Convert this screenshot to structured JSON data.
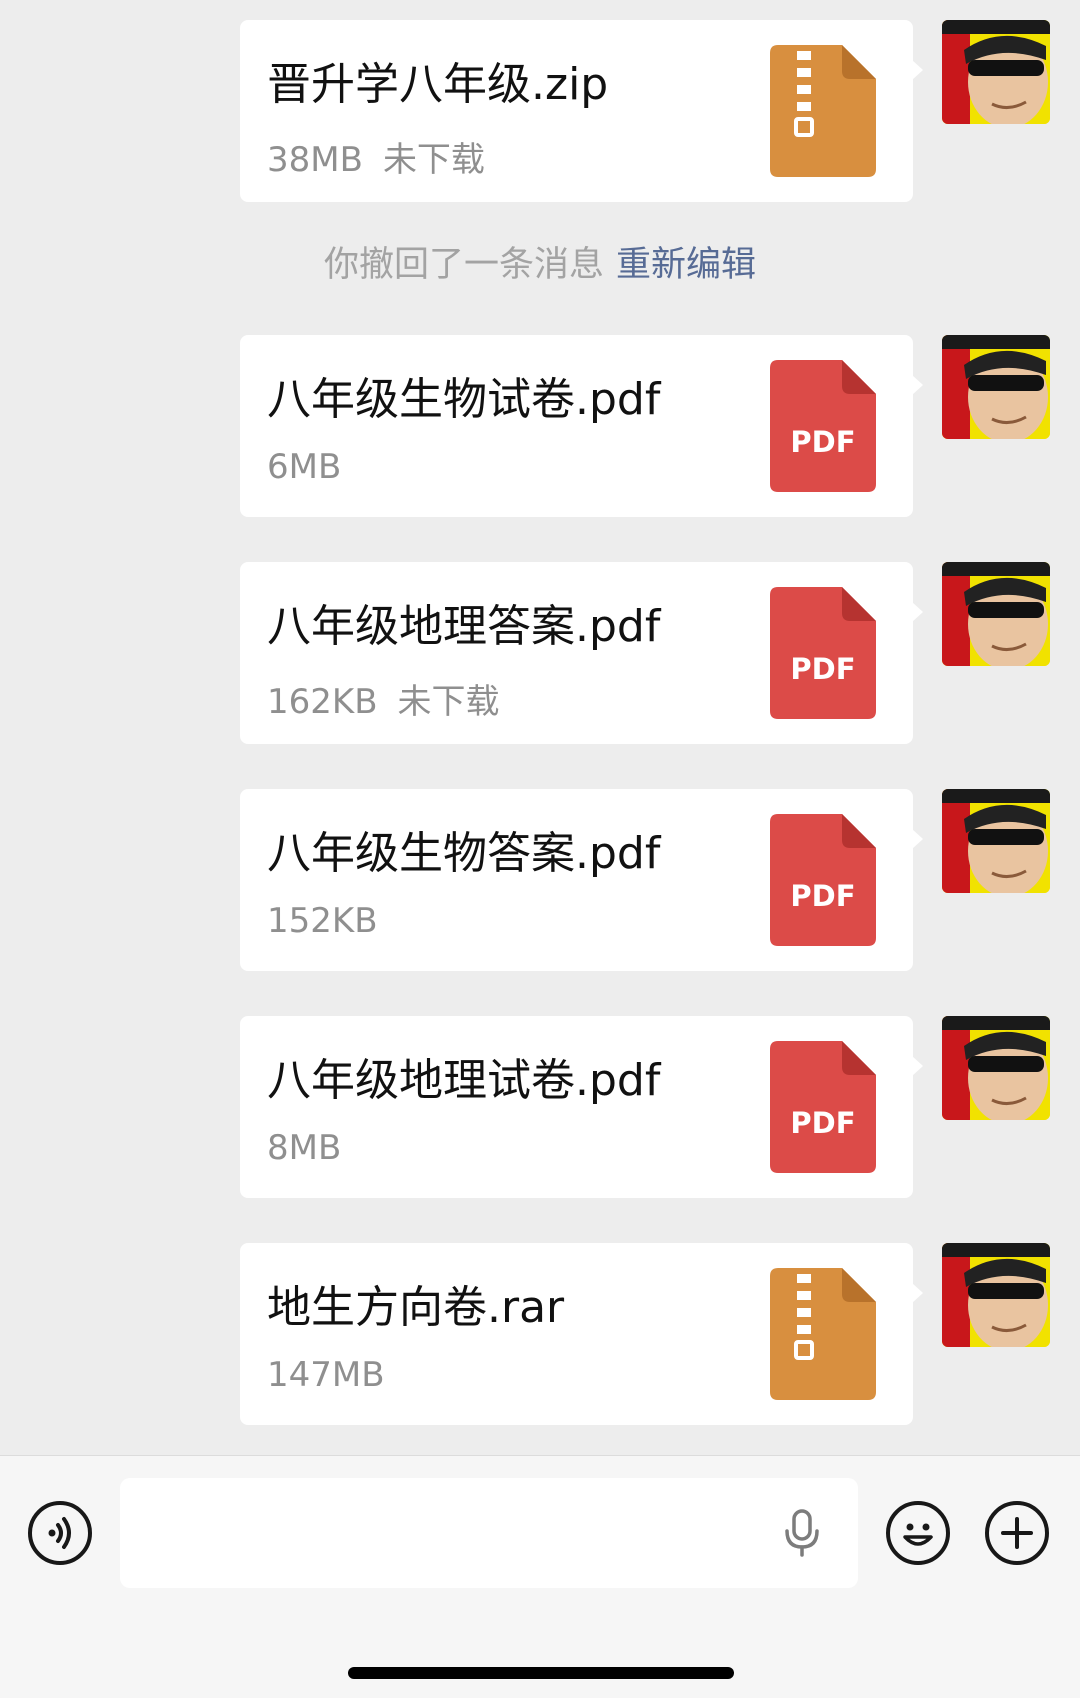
{
  "messages": [
    {
      "name": "晋升学八年级.zip",
      "size": "38MB",
      "status": "未下载",
      "type": "zip"
    },
    {
      "name": "八年级生物试卷.pdf",
      "size": "6MB",
      "status": "",
      "type": "pdf"
    },
    {
      "name": "八年级地理答案.pdf",
      "size": "162KB",
      "status": "未下载",
      "type": "pdf"
    },
    {
      "name": "八年级生物答案.pdf",
      "size": "152KB",
      "status": "",
      "type": "pdf"
    },
    {
      "name": "八年级地理试卷.pdf",
      "size": "8MB",
      "status": "",
      "type": "pdf"
    },
    {
      "name": "地生方向卷.rar",
      "size": "147MB",
      "status": "",
      "type": "zip"
    }
  ],
  "notice": {
    "text": "你撤回了一条消息",
    "link": "重新编辑"
  },
  "pdf_label": "PDF",
  "input": {
    "value": "",
    "placeholder": ""
  },
  "icons": {
    "voice": "voice-mode-icon",
    "mic": "microphone-icon",
    "emoji": "emoji-icon",
    "more": "plus-icon",
    "zip": "zip-file-icon",
    "pdf": "pdf-file-icon"
  },
  "colors": {
    "background": "#ededed",
    "bubble": "#ffffff",
    "pdf": "#dc4b48",
    "zip": "#d88f3f",
    "link": "#576b95"
  }
}
